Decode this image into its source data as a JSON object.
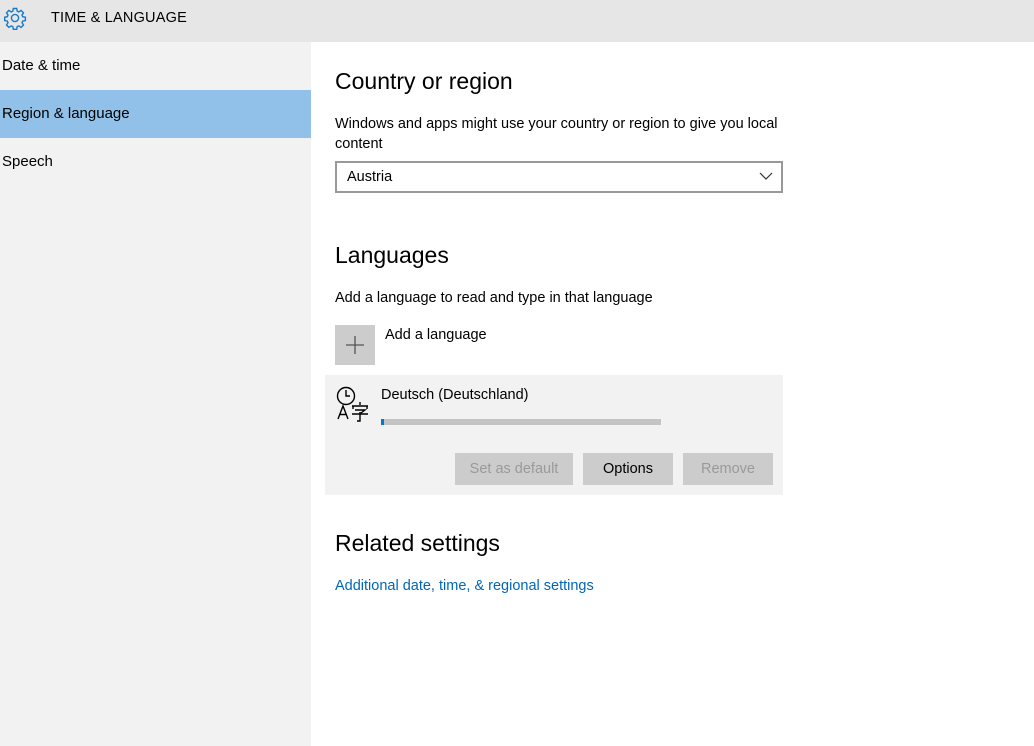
{
  "app": {
    "title": "TIME & LANGUAGE"
  },
  "sidebar": {
    "items": [
      {
        "label": "Date & time"
      },
      {
        "label": "Region & language"
      },
      {
        "label": "Speech"
      }
    ]
  },
  "country": {
    "heading": "Country or region",
    "description": "Windows and apps might use your country or region to give you local content",
    "selected": "Austria"
  },
  "languages": {
    "heading": "Languages",
    "description": "Add a language to read and type in that language",
    "add_label": "Add a language",
    "items": [
      {
        "name": "Deutsch (Deutschland)",
        "progress": 0.01,
        "set_default_label": "Set as default",
        "options_label": "Options",
        "remove_label": "Remove"
      }
    ]
  },
  "related": {
    "heading": "Related settings",
    "link": "Additional date, time, & regional settings"
  },
  "colors": {
    "accent": "#0078d7",
    "selected_nav": "#91c1e8",
    "link": "#0067b8"
  },
  "icons": [
    "gear-icon",
    "chevron-down-icon",
    "plus-icon",
    "language-icon"
  ]
}
